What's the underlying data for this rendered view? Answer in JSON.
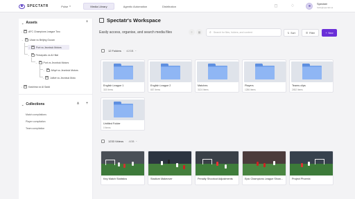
{
  "header": {
    "logo_text": "SPECTATR",
    "nav": [
      {
        "label": "Pulse",
        "dropdown": true,
        "active": false
      },
      {
        "label": "Media Library",
        "dropdown": false,
        "active": true
      },
      {
        "label": "Agentic Automation",
        "dropdown": false,
        "active": false
      },
      {
        "label": "Distribution",
        "dropdown": false,
        "active": false
      }
    ],
    "icons": [
      "chat-icon",
      "bell-icon"
    ],
    "user": {
      "name": "Spectatr",
      "email": "hello@spectatr.ai"
    }
  },
  "sidebar": {
    "assets_title": "Assets",
    "tree": [
      {
        "label": "AFC Champions League Two",
        "level": 0,
        "expanded": false
      },
      {
        "label": "Ulsan vs Beijing Guoan",
        "level": 0,
        "expanded": true
      },
      {
        "label": "Port vs Jeonbuk Motors",
        "level": 1,
        "expanded": false,
        "selected": true
      },
      {
        "label": "Persepolis vs Al Hilal",
        "level": 1,
        "expanded": true
      },
      {
        "label": "Port vs Jeonbuk Motors",
        "level": 2,
        "expanded": true
      },
      {
        "label": "Alhyrt vs Jeonbuk Motors",
        "level": 3,
        "expanded": true
      },
      {
        "label": "Julfort vs Jeonbuk Moto",
        "level": 3,
        "expanded": false
      },
      {
        "label": "Kashima vs Al Sadd",
        "level": 0,
        "expanded": false
      }
    ],
    "collections_title": "Collections",
    "collections": [
      "Match compilations",
      "Player compilation",
      "Team compilation"
    ]
  },
  "main": {
    "title": "Spectatr's Workspace",
    "subtitle": "Easily access, organise, and search media files",
    "search_placeholder": "Search for files, folders, and content",
    "sort_label": "Sort",
    "filter_label": "Filter",
    "new_label": "New",
    "folders_section": {
      "count_label": "12 Folders",
      "size": "42GB"
    },
    "folders": [
      {
        "name": "English League 1",
        "count": "315 Items"
      },
      {
        "name": "English League 2",
        "count": "667 Items"
      },
      {
        "name": "Matches",
        "count": "3124 Items"
      },
      {
        "name": "Players",
        "count": "1286 Items"
      },
      {
        "name": "Teams clips",
        "count": "2452 Items"
      },
      {
        "name": "Untitled Folder",
        "count": "0 Items"
      }
    ],
    "videos_section": {
      "count_label": "1233 Videos",
      "size": "4GB"
    },
    "videos": [
      {
        "title": "Key Match Statistics"
      },
      {
        "title": "Stadium Makeover"
      },
      {
        "title": "Penalty Shootout Adjustments"
      },
      {
        "title": "Epic Champions League Show..."
      },
      {
        "title": "Project Phoenix"
      }
    ]
  },
  "colors": {
    "accent": "#6a2fd8",
    "brand": "#5b3fc4",
    "folder": "#79a6ee",
    "pitch": "#3d7a3a"
  }
}
